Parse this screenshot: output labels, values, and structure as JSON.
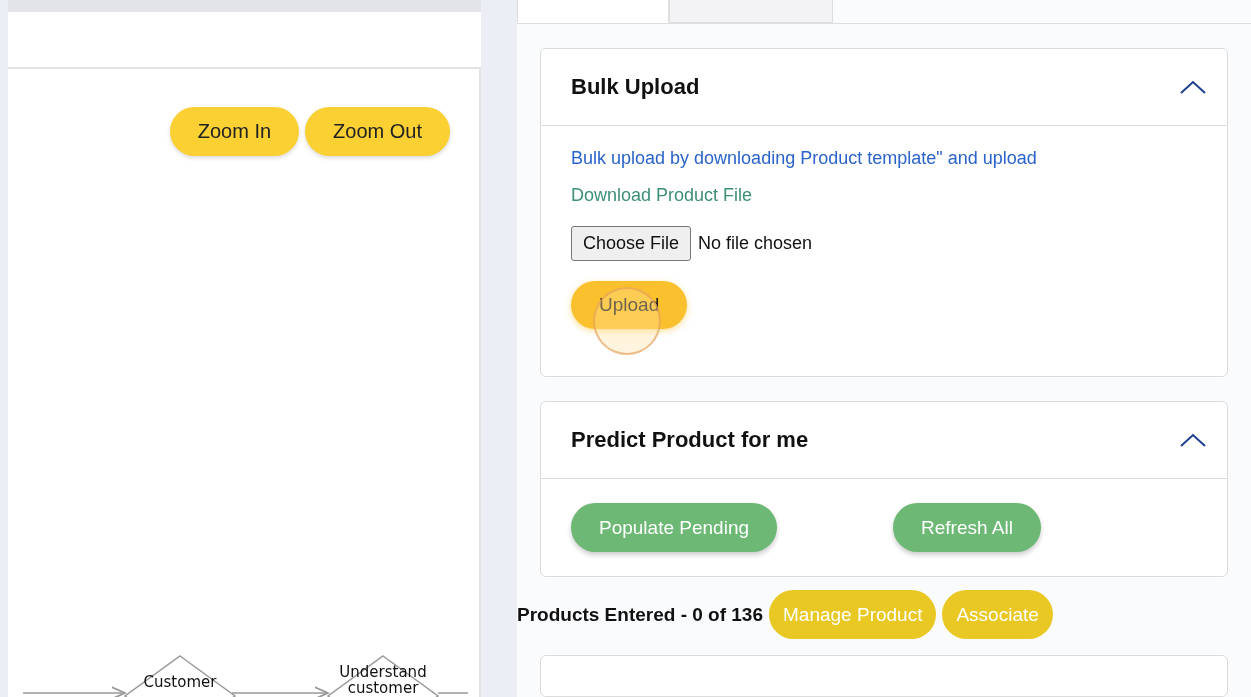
{
  "left_panel": {
    "zoom_buttons": [
      "Zoom In",
      "Zoom Out"
    ],
    "diagram": {
      "nodes": [
        {
          "kind": "decision",
          "label": [
            "Customer"
          ]
        },
        {
          "kind": "decision",
          "label": [
            "Understand",
            "customer"
          ]
        }
      ]
    }
  },
  "tabs": [
    {
      "selected": true
    },
    {
      "selected": false
    }
  ],
  "bulk_upload": {
    "title": "Bulk Upload",
    "expanded": true,
    "description": "Bulk upload by downloading Product template\" and upload",
    "download_link": "Download Product File",
    "file_button": "Choose File",
    "file_status": "No file chosen",
    "upload_button": "Upload"
  },
  "predict": {
    "title": "Predict Product for me",
    "expanded": true,
    "buttons": [
      "Populate Pending",
      "Refresh All"
    ]
  },
  "products": {
    "summary": "Products Entered - 0 of 136",
    "buttons": [
      "Manage Product",
      "Associate"
    ]
  }
}
